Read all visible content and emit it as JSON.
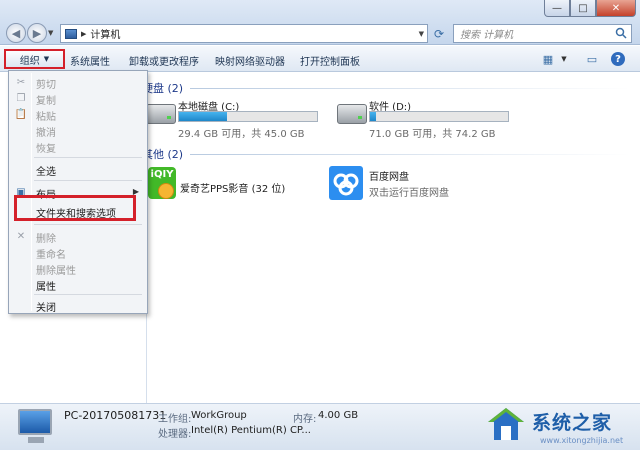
{
  "window": {
    "minimize": "—",
    "maximize": "□",
    "close": "✕"
  },
  "address": {
    "path": "计算机"
  },
  "search": {
    "placeholder": "搜索 计算机"
  },
  "toolbar": {
    "organize": "组织",
    "items": [
      "系统属性",
      "卸载或更改程序",
      "映射网络驱动器",
      "打开控制面板"
    ]
  },
  "groups": {
    "hard_disks": "硬盘 (2)",
    "other": "其他 (2)"
  },
  "drives": [
    {
      "name": "本地磁盘 (C:)",
      "info": "29.4 GB 可用，共 45.0 GB",
      "used_fraction": 0.35
    },
    {
      "name": "软件 (D:)",
      "info": "71.0 GB 可用，共 74.2 GB",
      "used_fraction": 0.04
    }
  ],
  "apps": [
    {
      "name": "爱奇艺PPS影音 (32 位)",
      "subtitle": ""
    },
    {
      "name": "百度网盘",
      "subtitle": "双击运行百度网盘"
    }
  ],
  "menu": {
    "cut": "剪切",
    "copy": "复制",
    "paste": "粘贴",
    "undo": "撤消",
    "redo": "恢复",
    "select_all": "全选",
    "layout": "布局",
    "folder_options": "文件夹和搜索选项",
    "delete": "删除",
    "rename": "重命名",
    "remove_properties": "删除属性",
    "properties": "属性",
    "close": "关闭"
  },
  "details": {
    "pc_name": "PC-201705081731",
    "workgroup_label": "工作组:",
    "workgroup": "WorkGroup",
    "memory_label": "内存:",
    "memory": "4.00 GB",
    "cpu_label": "处理器:",
    "cpu": "Intel(R) Pentium(R) CP..."
  },
  "watermark": {
    "text": "系统之家",
    "url": "www.xitongzhijia.net"
  },
  "colors": {
    "highlight": "#d4202a",
    "accent": "#1e3a8a",
    "bar": "#1e87c9"
  }
}
